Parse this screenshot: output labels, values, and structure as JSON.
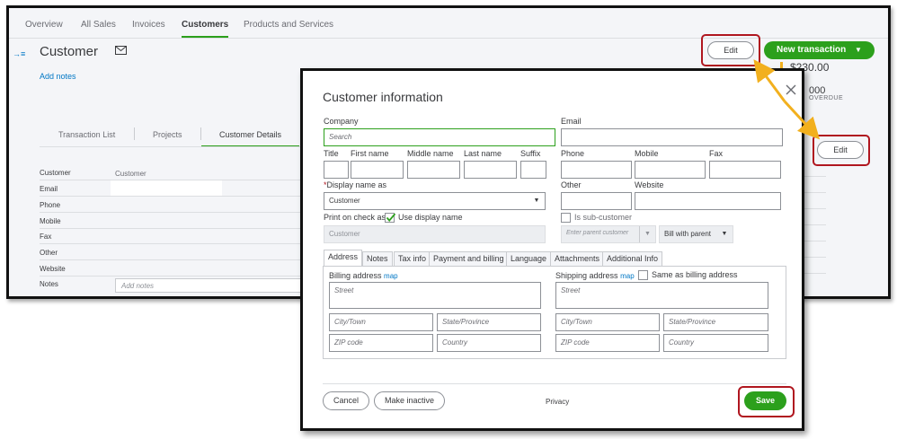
{
  "nav": {
    "tabs": [
      {
        "label": "Overview"
      },
      {
        "label": "All Sales"
      },
      {
        "label": "Invoices"
      },
      {
        "label": "Customers"
      },
      {
        "label": "Products and Services"
      }
    ],
    "active_tab": "Customers"
  },
  "customer_page": {
    "title": "Customer",
    "add_notes": "Add notes",
    "edit_label": "Edit",
    "new_transaction_label": "New transaction",
    "amount": "$230.00",
    "overdue_amount": "000",
    "overdue_label": "OVERDUE",
    "sub_tabs": [
      {
        "label": "Transaction List"
      },
      {
        "label": "Projects"
      },
      {
        "label": "Customer Details"
      }
    ],
    "details": [
      {
        "label": "Customer",
        "value": "Customer"
      },
      {
        "label": "Email",
        "value": ""
      },
      {
        "label": "Phone",
        "value": ""
      },
      {
        "label": "Mobile",
        "value": ""
      },
      {
        "label": "Fax",
        "value": ""
      },
      {
        "label": "Other",
        "value": ""
      },
      {
        "label": "Website",
        "value": ""
      },
      {
        "label": "Notes",
        "value": ""
      }
    ],
    "notes_placeholder": "Add notes"
  },
  "side_edit_label": "Edit",
  "dialog": {
    "title": "Customer information",
    "company_label": "Company",
    "company_placeholder": "Search",
    "email_label": "Email",
    "title_label": "Title",
    "first_name_label": "First name",
    "middle_name_label": "Middle name",
    "last_name_label": "Last name",
    "suffix_label": "Suffix",
    "phone_label": "Phone",
    "mobile_label": "Mobile",
    "fax_label": "Fax",
    "display_name_required": "*",
    "display_name_label": "Display name as",
    "display_name_value": "Customer",
    "other_label": "Other",
    "website_label": "Website",
    "print_on_check_label": "Print on check as",
    "use_display_name_label": "Use display name",
    "use_display_name_checked": true,
    "print_on_check_value": "Customer",
    "sub_customer_label": "Is sub-customer",
    "parent_customer_placeholder": "Enter parent customer",
    "bill_with_parent_value": "Bill with parent",
    "tabs": [
      {
        "label": "Address"
      },
      {
        "label": "Notes"
      },
      {
        "label": "Tax info"
      },
      {
        "label": "Payment and billing"
      },
      {
        "label": "Language"
      },
      {
        "label": "Attachments"
      },
      {
        "label": "Additional Info"
      }
    ],
    "billing_label": "Billing address",
    "shipping_label": "Shipping address",
    "map_link": "map",
    "same_as_billing_label": "Same as billing address",
    "street_placeholder": "Street",
    "city_placeholder": "City/Town",
    "state_placeholder": "State/Province",
    "zip_placeholder": "ZIP code",
    "country_placeholder": "Country",
    "cancel_label": "Cancel",
    "make_inactive_label": "Make inactive",
    "privacy_label": "Privacy",
    "save_label": "Save"
  },
  "colors": {
    "accent_green": "#2ca01c",
    "highlight_red": "#b0161f",
    "arrow_yellow": "#f2b01e",
    "link_blue": "#0077c5"
  }
}
